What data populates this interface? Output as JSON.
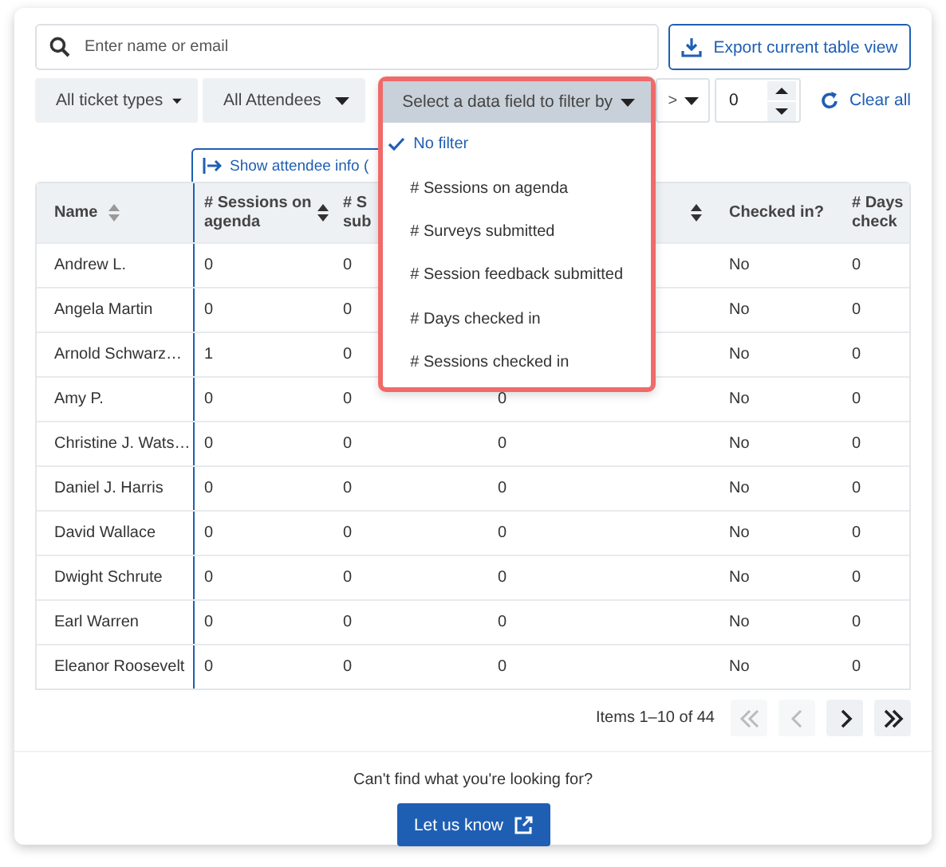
{
  "search": {
    "placeholder": "Enter name or email"
  },
  "export_button": {
    "label": "Export current table view"
  },
  "filters": [
    {
      "label": "All ticket types"
    },
    {
      "label": "All Attendees"
    }
  ],
  "field_filter": {
    "label": "Select a data field to filter by",
    "open": true,
    "options": [
      {
        "label": "No filter",
        "selected": true
      },
      {
        "label": "# Sessions on agenda",
        "selected": false
      },
      {
        "label": "# Surveys submitted",
        "selected": false
      },
      {
        "label": "# Session feedback submitted",
        "selected": false
      },
      {
        "label": "# Days checked in",
        "selected": false
      },
      {
        "label": "# Sessions checked in",
        "selected": false
      }
    ]
  },
  "operator": {
    "label": ">"
  },
  "value": {
    "value": "0"
  },
  "clear_all": {
    "label": "Clear all"
  },
  "table": {
    "show_attendee_info": {
      "label": "Show attendee info ("
    },
    "columns": [
      {
        "label": "Name",
        "sortable": true
      },
      {
        "label": "# Sessions on\nagenda",
        "sortable": true
      },
      {
        "label": "# S\nsub",
        "sortable": false
      },
      {
        "sortable": true
      },
      {
        "label": "Checked in?",
        "sortable": false
      },
      {
        "label": "# Days\ncheck",
        "sortable": false
      }
    ],
    "rows": [
      {
        "cells": [
          "Andrew L.",
          "0",
          "0",
          "",
          "No",
          "0"
        ]
      },
      {
        "cells": [
          "Angela Martin",
          "0",
          "0",
          "",
          "No",
          "0"
        ]
      },
      {
        "cells": [
          "Arnold Schwarz…",
          "1",
          "0",
          "",
          "No",
          "0"
        ]
      },
      {
        "cells": [
          "Amy P.",
          "0",
          "0",
          "0",
          "No",
          "0"
        ]
      },
      {
        "cells": [
          "Christine J. Wats…",
          "0",
          "0",
          "0",
          "No",
          "0"
        ]
      },
      {
        "cells": [
          "Daniel J. Harris",
          "0",
          "0",
          "0",
          "No",
          "0"
        ]
      },
      {
        "cells": [
          "David Wallace",
          "0",
          "0",
          "0",
          "No",
          "0"
        ]
      },
      {
        "cells": [
          "Dwight Schrute",
          "0",
          "0",
          "0",
          "No",
          "0"
        ]
      },
      {
        "cells": [
          "Earl Warren",
          "0",
          "0",
          "0",
          "No",
          "0"
        ]
      },
      {
        "cells": [
          "Eleanor Roosevelt",
          "0",
          "0",
          "0",
          "No",
          "0"
        ]
      }
    ]
  },
  "pagination": {
    "summary": "Items 1–10 of 44",
    "buttons": [
      {
        "kind": "first",
        "disabled": true
      },
      {
        "kind": "prev",
        "disabled": true
      },
      {
        "kind": "next",
        "disabled": false
      },
      {
        "kind": "last",
        "disabled": false
      }
    ]
  },
  "footer": {
    "question": "Can't find what you're looking for?",
    "button": "Let us know"
  }
}
